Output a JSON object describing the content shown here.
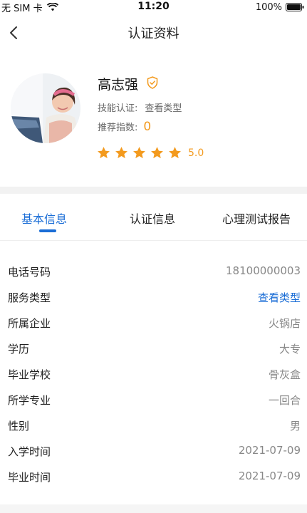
{
  "status_bar": {
    "carrier": "无 SIM 卡",
    "time": "11:20",
    "battery": "100%"
  },
  "nav": {
    "title": "认证资料",
    "back_icon": "chevron-left-icon"
  },
  "profile": {
    "name": "高志强",
    "verified_icon": "shield-check-icon",
    "skill_label": "技能认证:",
    "skill_link": "查看类型",
    "recommend_label": "推荐指数:",
    "recommend_value": "0",
    "stars": 5,
    "rating": "5.0"
  },
  "tabs": [
    {
      "label": "基本信息",
      "active": true
    },
    {
      "label": "认证信息",
      "active": false
    },
    {
      "label": "心理测试报告",
      "active": false
    }
  ],
  "info_rows": [
    {
      "label": "电话号码",
      "value": "18100000003",
      "link": false
    },
    {
      "label": "服务类型",
      "value": "查看类型",
      "link": true
    },
    {
      "label": "所属企业",
      "value": "火锅店",
      "link": false
    },
    {
      "label": "学历",
      "value": "大专",
      "link": false
    },
    {
      "label": "毕业学校",
      "value": "骨灰盒",
      "link": false
    },
    {
      "label": "所学专业",
      "value": "一回合",
      "link": false
    },
    {
      "label": "性别",
      "value": "男",
      "link": false
    },
    {
      "label": "入学时间",
      "value": "2021-07-09",
      "link": false
    },
    {
      "label": "毕业时间",
      "value": "2021-07-09",
      "link": false
    }
  ],
  "colors": {
    "accent": "#1a6dd6",
    "star": "#f39a1e",
    "muted": "#888888"
  }
}
